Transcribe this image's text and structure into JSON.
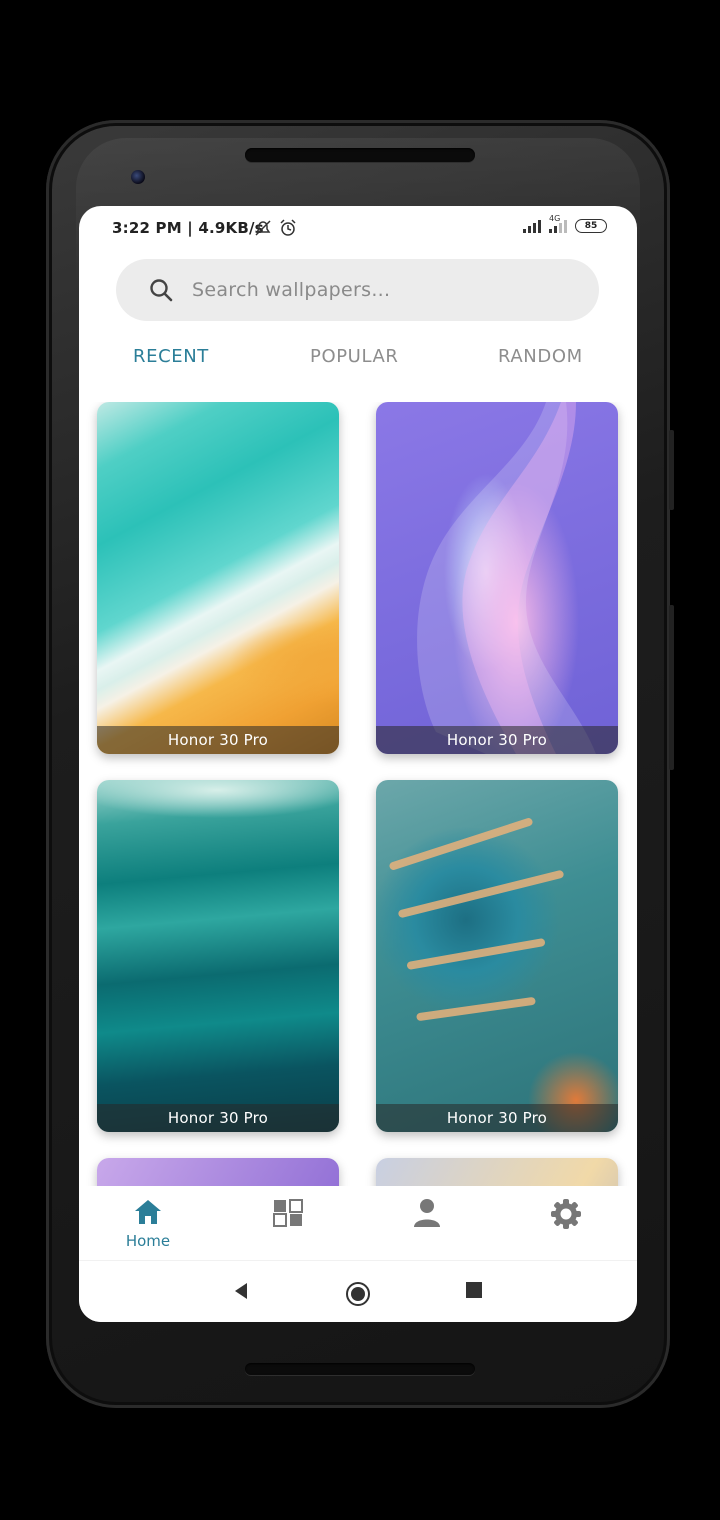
{
  "status_bar": {
    "time_speed": "3:22 PM | 4.9KB/s",
    "network_label": "4G",
    "battery": "85"
  },
  "search": {
    "placeholder": "Search wallpapers..."
  },
  "tabs": [
    {
      "label": "RECENT",
      "active": true
    },
    {
      "label": "POPULAR",
      "active": false
    },
    {
      "label": "RANDOM",
      "active": false
    }
  ],
  "wallpapers": [
    {
      "title": "Honor 30 Pro"
    },
    {
      "title": "Honor 30 Pro"
    },
    {
      "title": "Honor 30 Pro"
    },
    {
      "title": "Honor 30 Pro"
    }
  ],
  "bottom_nav": {
    "home_label": "Home",
    "items": [
      "home-icon",
      "categories-icon",
      "profile-icon",
      "settings-icon"
    ]
  },
  "colors": {
    "accent": "#2b7e98",
    "inactive": "#8d8d8d"
  }
}
